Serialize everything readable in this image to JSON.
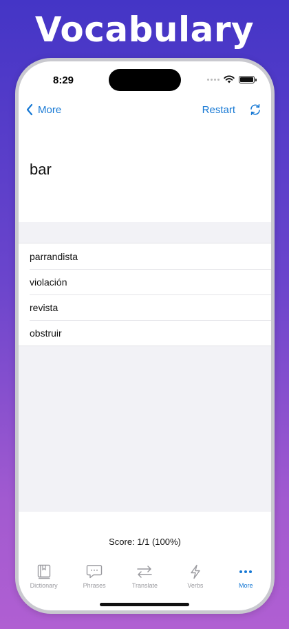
{
  "headline": "Vocabulary",
  "status": {
    "time": "8:29"
  },
  "nav": {
    "back_label": "More",
    "restart_label": "Restart"
  },
  "quiz": {
    "word": "bar",
    "answers": [
      "parrandista",
      "violación",
      "revista",
      "obstruir"
    ],
    "score": "Score: 1/1 (100%)"
  },
  "tabs": [
    {
      "label": "Dictionary",
      "icon": "book-icon",
      "active": false
    },
    {
      "label": "Phrases",
      "icon": "speech-bubble-icon",
      "active": false
    },
    {
      "label": "Translate",
      "icon": "arrows-swap-icon",
      "active": false
    },
    {
      "label": "Verbs",
      "icon": "bolt-icon",
      "active": false
    },
    {
      "label": "More",
      "icon": "ellipsis-icon",
      "active": true
    }
  ],
  "colors": {
    "accent": "#1678d4",
    "inactive": "#9a9a9f",
    "background_top": "#4435c6",
    "background_bottom": "#b05fd2"
  }
}
